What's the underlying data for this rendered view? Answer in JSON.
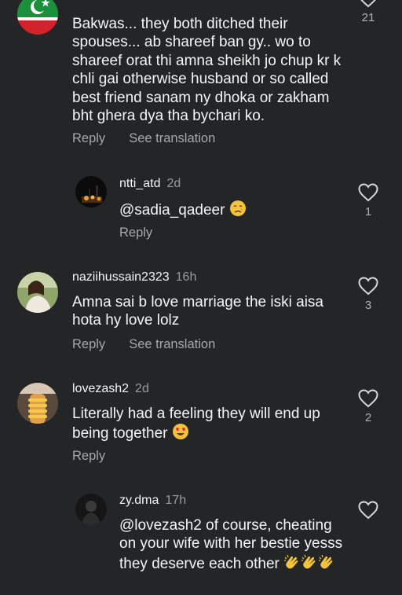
{
  "comments": [
    {
      "text": "Bakwas... they both ditched their spouses... ab shareef ban gy.. wo to shareef orat thi amna sheikh jo chup kr k chli gai otherwise husband or so called best friend sanam ny dhoka or zakham bht ghera dya tha bychari ko.",
      "reply": "Reply",
      "see_translation": "See translation",
      "likes": "21"
    },
    {
      "username": "ntti_atd",
      "time": "2d",
      "text": "@sadia_qadeer",
      "reply": "Reply",
      "likes": "1"
    },
    {
      "username": "naziihussain2323",
      "time": "16h",
      "text": "Amna sai b love marriage the iski aisa hota hy love lolz",
      "reply": "Reply",
      "see_translation": "See translation",
      "likes": "3"
    },
    {
      "username": "lovezash2",
      "time": "2d",
      "text": "Literally had a feeling they will end up being together",
      "reply": "Reply",
      "likes": "2"
    },
    {
      "username": "zy.dma",
      "time": "17h",
      "text": "@lovezash2 of course, cheating on your wife with her bestie yesss they deserve each other"
    }
  ],
  "icons": {
    "like": "heart-outline-icon",
    "crying": "crying-face-emoji",
    "heart_eyes": "heart-eyes-emoji",
    "clap": "clapping-hands-emoji"
  },
  "colors": {
    "background": "#242526",
    "text": "#f5f5f5",
    "muted": "#a8a8a8",
    "flag_green": "#1a8f3c",
    "flag_red": "#d3232a"
  }
}
